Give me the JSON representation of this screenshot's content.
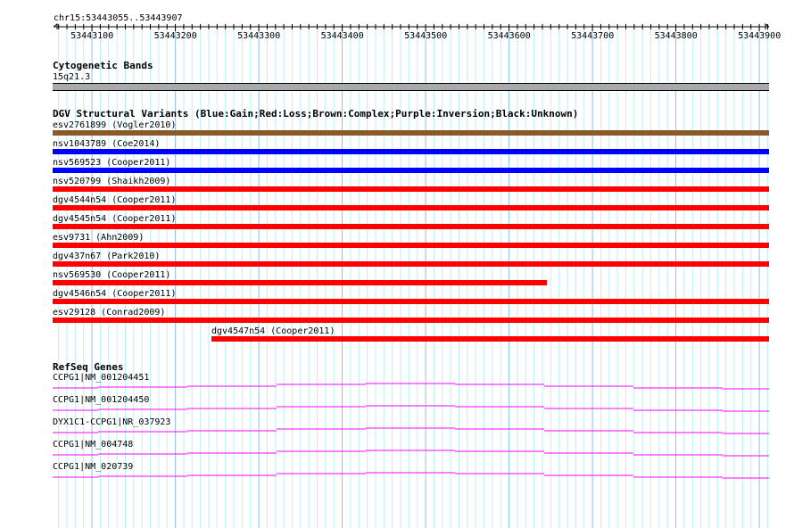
{
  "ruler": {
    "range": "chr15:53443055..53443907",
    "ticks": [
      "53443100",
      "53443200",
      "53443300",
      "53443400",
      "53443500",
      "53443600",
      "53443700",
      "53443800",
      "53443900"
    ]
  },
  "cyto": {
    "title": "Cytogenetic Bands",
    "band": "15q21.3"
  },
  "dgv": {
    "title": "DGV Structural Variants (Blue:Gain;Red:Loss;Brown:Complex;Purple:Inversion;Black:Unknown)",
    "items": [
      {
        "label": "esv2761899 (Vogler2010)",
        "color": "#8b5a2b"
      },
      {
        "label": "nsv1043789 (Coe2014)",
        "color": "#0000ff"
      },
      {
        "label": "nsv569523 (Cooper2011)",
        "color": "#0000ff"
      },
      {
        "label": "nsv520799 (Shaikh2009)",
        "color": "#ff0000"
      },
      {
        "label": "dgv4544n54 (Cooper2011)",
        "color": "#ff0000"
      },
      {
        "label": "dgv4545n54 (Cooper2011)",
        "color": "#ff0000"
      },
      {
        "label": "esv9731 (Ahn2009)",
        "color": "#ff0000"
      },
      {
        "label": "dgv437n67 (Park2010)",
        "color": "#ff0000"
      },
      {
        "label": "nsv569530 (Cooper2011)",
        "color": "#ff0000"
      },
      {
        "label": "dgv4546n54 (Cooper2011)",
        "color": "#ff0000"
      },
      {
        "label": "esv29128 (Conrad2009)",
        "color": "#ff0000"
      },
      {
        "label": "dgv4547n54 (Cooper2011)",
        "color": "#ff0000"
      }
    ]
  },
  "refseq": {
    "title": "RefSeq Genes",
    "color": "#ff00ff",
    "items": [
      "CCPG1|NM_001204451",
      "CCPG1|NM_001204450",
      "DYX1C1-CCPG1|NR_037923",
      "CCPG1|NM_004748",
      "CCPG1|NM_020739"
    ]
  }
}
